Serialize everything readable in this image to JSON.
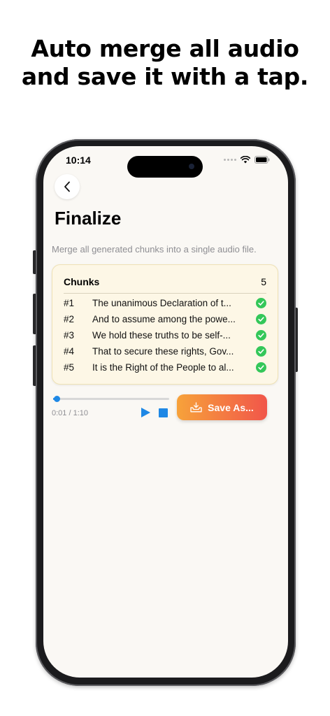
{
  "headline": {
    "line1": "Auto merge all audio",
    "line2": "and save it with a tap."
  },
  "status_bar": {
    "time": "10:14"
  },
  "screen": {
    "title": "Finalize",
    "subtitle": "Merge all generated chunks into a single audio file.",
    "chunks": {
      "label": "Chunks",
      "count": "5",
      "items": [
        {
          "number": "#1",
          "text": "The unanimous Declaration of t...",
          "status": "done"
        },
        {
          "number": "#2",
          "text": "And to assume among the powe...",
          "status": "done"
        },
        {
          "number": "#3",
          "text": "We hold these truths to be self-...",
          "status": "done"
        },
        {
          "number": "#4",
          "text": "That to secure these rights, Gov...",
          "status": "done"
        },
        {
          "number": "#5",
          "text": "It is the Right of the People to al...",
          "status": "done"
        }
      ]
    },
    "player": {
      "time_readout": "0:01 / 1:10",
      "progress_fraction": 0.014
    },
    "save_button_label": "Save As..."
  },
  "colors": {
    "accent_blue": "#1e88e5",
    "check_green": "#34c759",
    "card_background": "#fdf7e6",
    "save_gradient_start": "#f7a23a",
    "save_gradient_end": "#f1564a"
  },
  "icons": {
    "back": "chevron-left-icon",
    "play": "play-icon",
    "stop": "stop-icon",
    "save": "tray-download-icon",
    "check": "checkmark-circle-icon",
    "wifi": "wifi-icon",
    "battery": "battery-icon"
  }
}
